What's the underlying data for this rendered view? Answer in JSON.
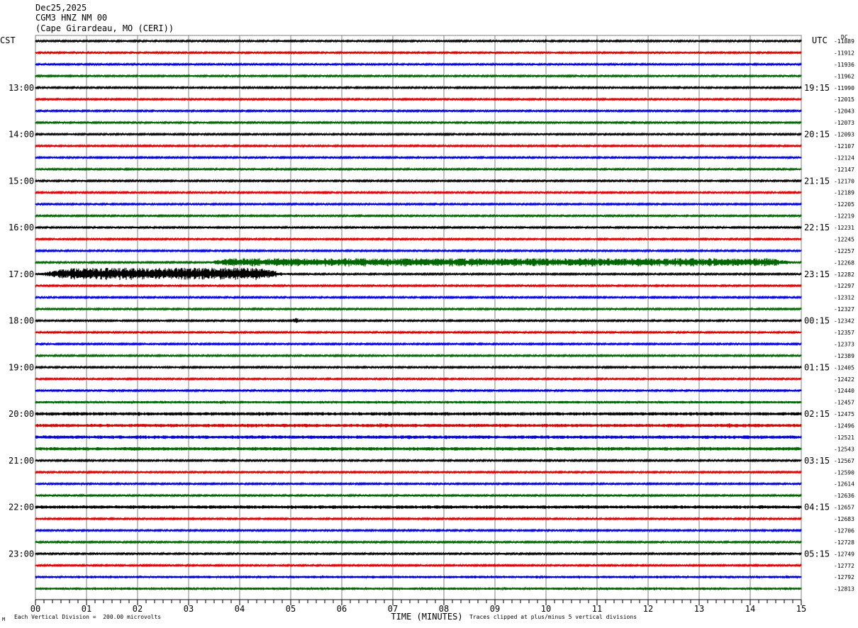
{
  "header": {
    "date": "Dec25,2025",
    "station": "CGM3 HNZ NM 00",
    "location": "(Cape Girardeau, MO (CERI))"
  },
  "left_timezone": "CST",
  "right_timezone": "UTC",
  "dc_label": "DC",
  "footer": {
    "scale_note": "Each Vertical Division =  200.00 microvolts",
    "clip_note": "Traces clipped at plus/minus 5 vertical divisions",
    "corner_mark": "M"
  },
  "colors": {
    "trace_cycle": [
      "#000000",
      "#dd0000",
      "#0000dd",
      "#006600"
    ],
    "grid": "#808080",
    "background": "#ffffff"
  },
  "chart_data": {
    "type": "line",
    "title": "",
    "xlabel": "TIME (MINUTES)",
    "xlim": [
      0,
      15
    ],
    "x_ticks": [
      "00",
      "01",
      "02",
      "03",
      "04",
      "05",
      "06",
      "07",
      "08",
      "09",
      "10",
      "11",
      "12",
      "13",
      "14",
      "15"
    ],
    "left_hour_labels": [
      "13:00",
      "14:00",
      "15:00",
      "16:00",
      "17:00",
      "18:00",
      "19:00",
      "20:00",
      "21:00",
      "22:00",
      "23:00"
    ],
    "right_hour_labels": [
      "19:15",
      "20:15",
      "21:15",
      "22:15",
      "23:15",
      "00:15",
      "01:15",
      "02:15",
      "03:15",
      "04:15",
      "05:15"
    ],
    "dc_offsets": [
      -11889,
      -11912,
      -11936,
      -11962,
      -11990,
      -12015,
      -12043,
      -12073,
      -12093,
      -12107,
      -12124,
      -12147,
      -12170,
      -12189,
      -12205,
      -12219,
      -12231,
      -12245,
      -12257,
      -12268,
      -12282,
      -12297,
      -12312,
      -12327,
      -12342,
      -12357,
      -12373,
      -12389,
      -12405,
      -12422,
      -12440,
      -12457,
      -12475,
      -12496,
      -12521,
      -12543,
      -12567,
      -12590,
      -12614,
      -12636,
      -12657,
      -12683,
      -12706,
      -12728,
      -12749,
      -12772,
      -12792,
      -12813
    ],
    "first_hour_row": 4,
    "rows_per_hour": 4,
    "trace_noise": [
      1,
      1,
      1,
      1,
      1,
      1,
      1,
      1,
      1,
      1,
      1,
      1,
      1,
      1,
      1,
      1,
      1,
      1,
      1,
      1,
      1,
      1,
      1,
      1,
      1,
      1,
      1,
      1,
      1,
      1,
      1,
      1.5,
      2,
      2,
      2,
      2,
      1,
      1,
      1,
      1,
      2,
      1,
      1,
      1,
      1,
      1,
      1.5,
      1.5
    ],
    "events": [
      {
        "row": 19,
        "start_min": 3.2,
        "end_min": 15,
        "amplitude": 6
      },
      {
        "row": 20,
        "start_min": 0,
        "end_min": 5,
        "amplitude": 9
      },
      {
        "row": 24,
        "start_min": 5.05,
        "end_min": 5.15,
        "amplitude": 4
      },
      {
        "row": 33,
        "start_min": 6.75,
        "end_min": 6.8,
        "amplitude": 4
      },
      {
        "row": 33,
        "start_min": 13.55,
        "end_min": 13.6,
        "amplitude": 4
      }
    ]
  }
}
